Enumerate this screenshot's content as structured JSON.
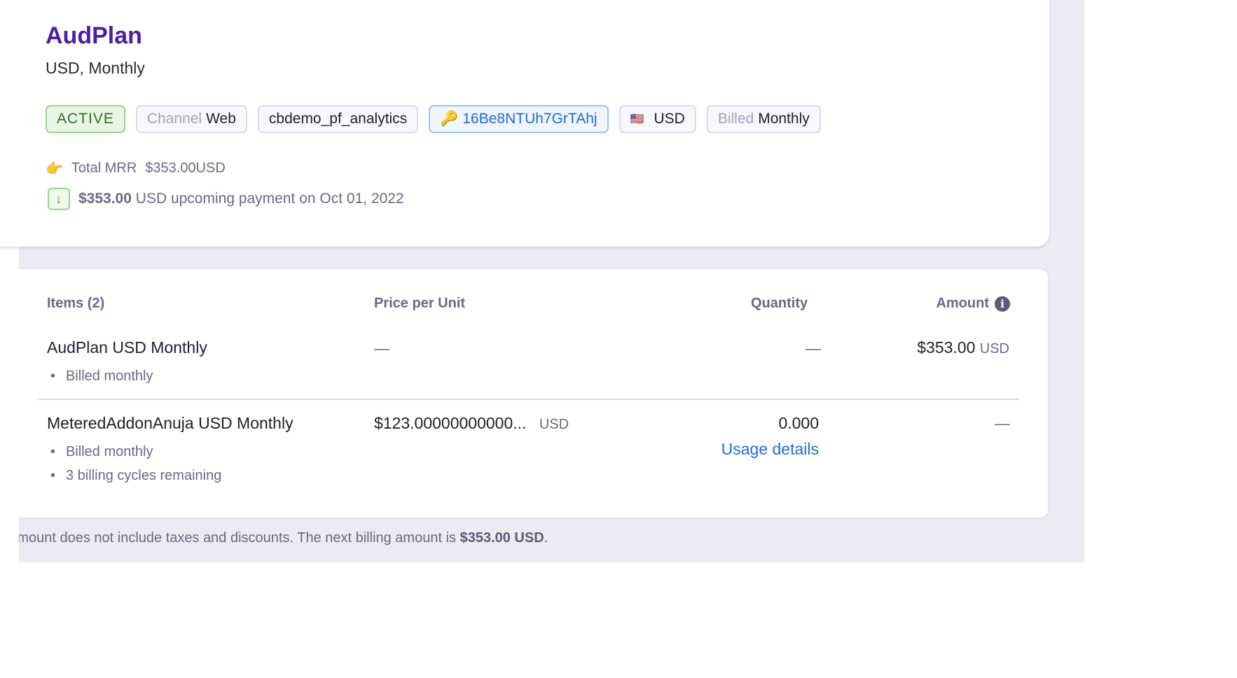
{
  "plan": {
    "title": "AudPlan",
    "subtitle": "USD, Monthly"
  },
  "tags": {
    "status": "ACTIVE",
    "channel_label": "Channel",
    "channel_value": "Web",
    "site": "cbdemo_pf_analytics",
    "id": "16Be8NTUh7GrTAhj",
    "currency": "USD",
    "billed_label": "Billed",
    "billed_value": "Monthly"
  },
  "mrr": {
    "label": "Total MRR",
    "value": "$353.00USD"
  },
  "upcoming": {
    "amount": "$353.00",
    "text": "USD upcoming payment on Oct 01, 2022"
  },
  "table": {
    "headers": {
      "items": "Items (2)",
      "price": "Price per Unit",
      "quantity": "Quantity",
      "amount": "Amount"
    },
    "rows": [
      {
        "name": "AudPlan USD Monthly",
        "details": [
          "Billed monthly"
        ],
        "price": "—",
        "quantity": "—",
        "amount": "$353.00",
        "amount_currency": "USD"
      },
      {
        "name": "MeteredAddonAnuja USD Monthly",
        "details": [
          "Billed monthly",
          "3 billing cycles remaining"
        ],
        "price": "$123.00000000000...",
        "price_currency": "USD",
        "quantity": "0.000",
        "usage_link": "Usage details",
        "amount": "—"
      }
    ]
  },
  "footer": {
    "text": "Amount does not include taxes and discounts. The next billing amount is ",
    "amount": "$353.00 USD",
    "end": "."
  },
  "colors": {
    "accent": "#4a1fa8",
    "link": "#1c6ce0",
    "active": "#2f6e2a"
  }
}
